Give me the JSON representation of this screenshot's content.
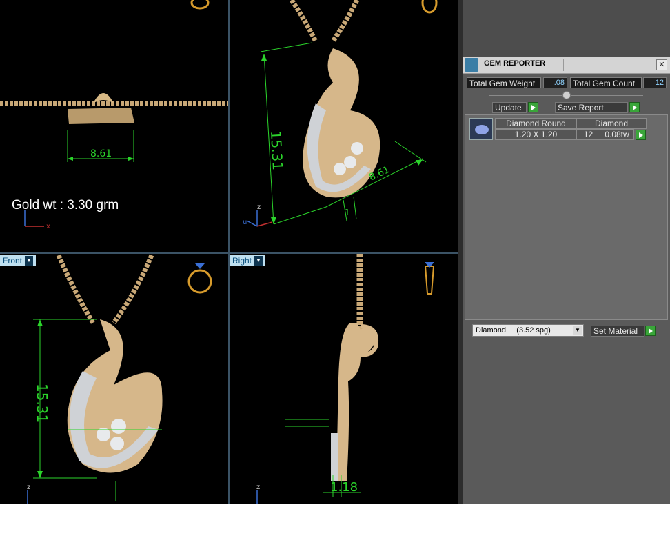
{
  "viewports": {
    "top_left": {
      "annotation": "Gold wt : 3.30 grm",
      "dimension": "8.61",
      "axis_z": "",
      "axis_x": "x"
    },
    "top_right": {
      "dimension_height": "15.31",
      "dimension_width": "8.61",
      "dimension_depth": "1",
      "axis_z": "z",
      "axis_y": "u"
    },
    "bottom_left": {
      "label": "Front",
      "dimension_height": "15.31",
      "axis_z": "z"
    },
    "bottom_right": {
      "label": "Right",
      "dimension_thickness": "1.18",
      "axis_z": "z"
    }
  },
  "gem_reporter": {
    "title": "GEM REPORTER",
    "close_label": "✕",
    "total_weight_label": "Total Gem Weight",
    "total_weight_value": ".08",
    "total_count_label": "Total Gem Count",
    "total_count_value": "12",
    "update_label": "Update",
    "save_report_label": "Save Report",
    "gems": [
      {
        "shape": "Diamond Round",
        "size": "1.20 X 1.20",
        "material": "Diamond",
        "count": "12",
        "weight": "0.08tw"
      }
    ],
    "material_select": "Diamond     (3.52 spg)",
    "set_material_label": "Set Material"
  },
  "colors": {
    "dimension": "#2bd42b",
    "viewport_bg": "#000000",
    "panel_bg": "#4d4d4d",
    "value_text": "#8fd3ff",
    "gold": "#d9b98a"
  }
}
